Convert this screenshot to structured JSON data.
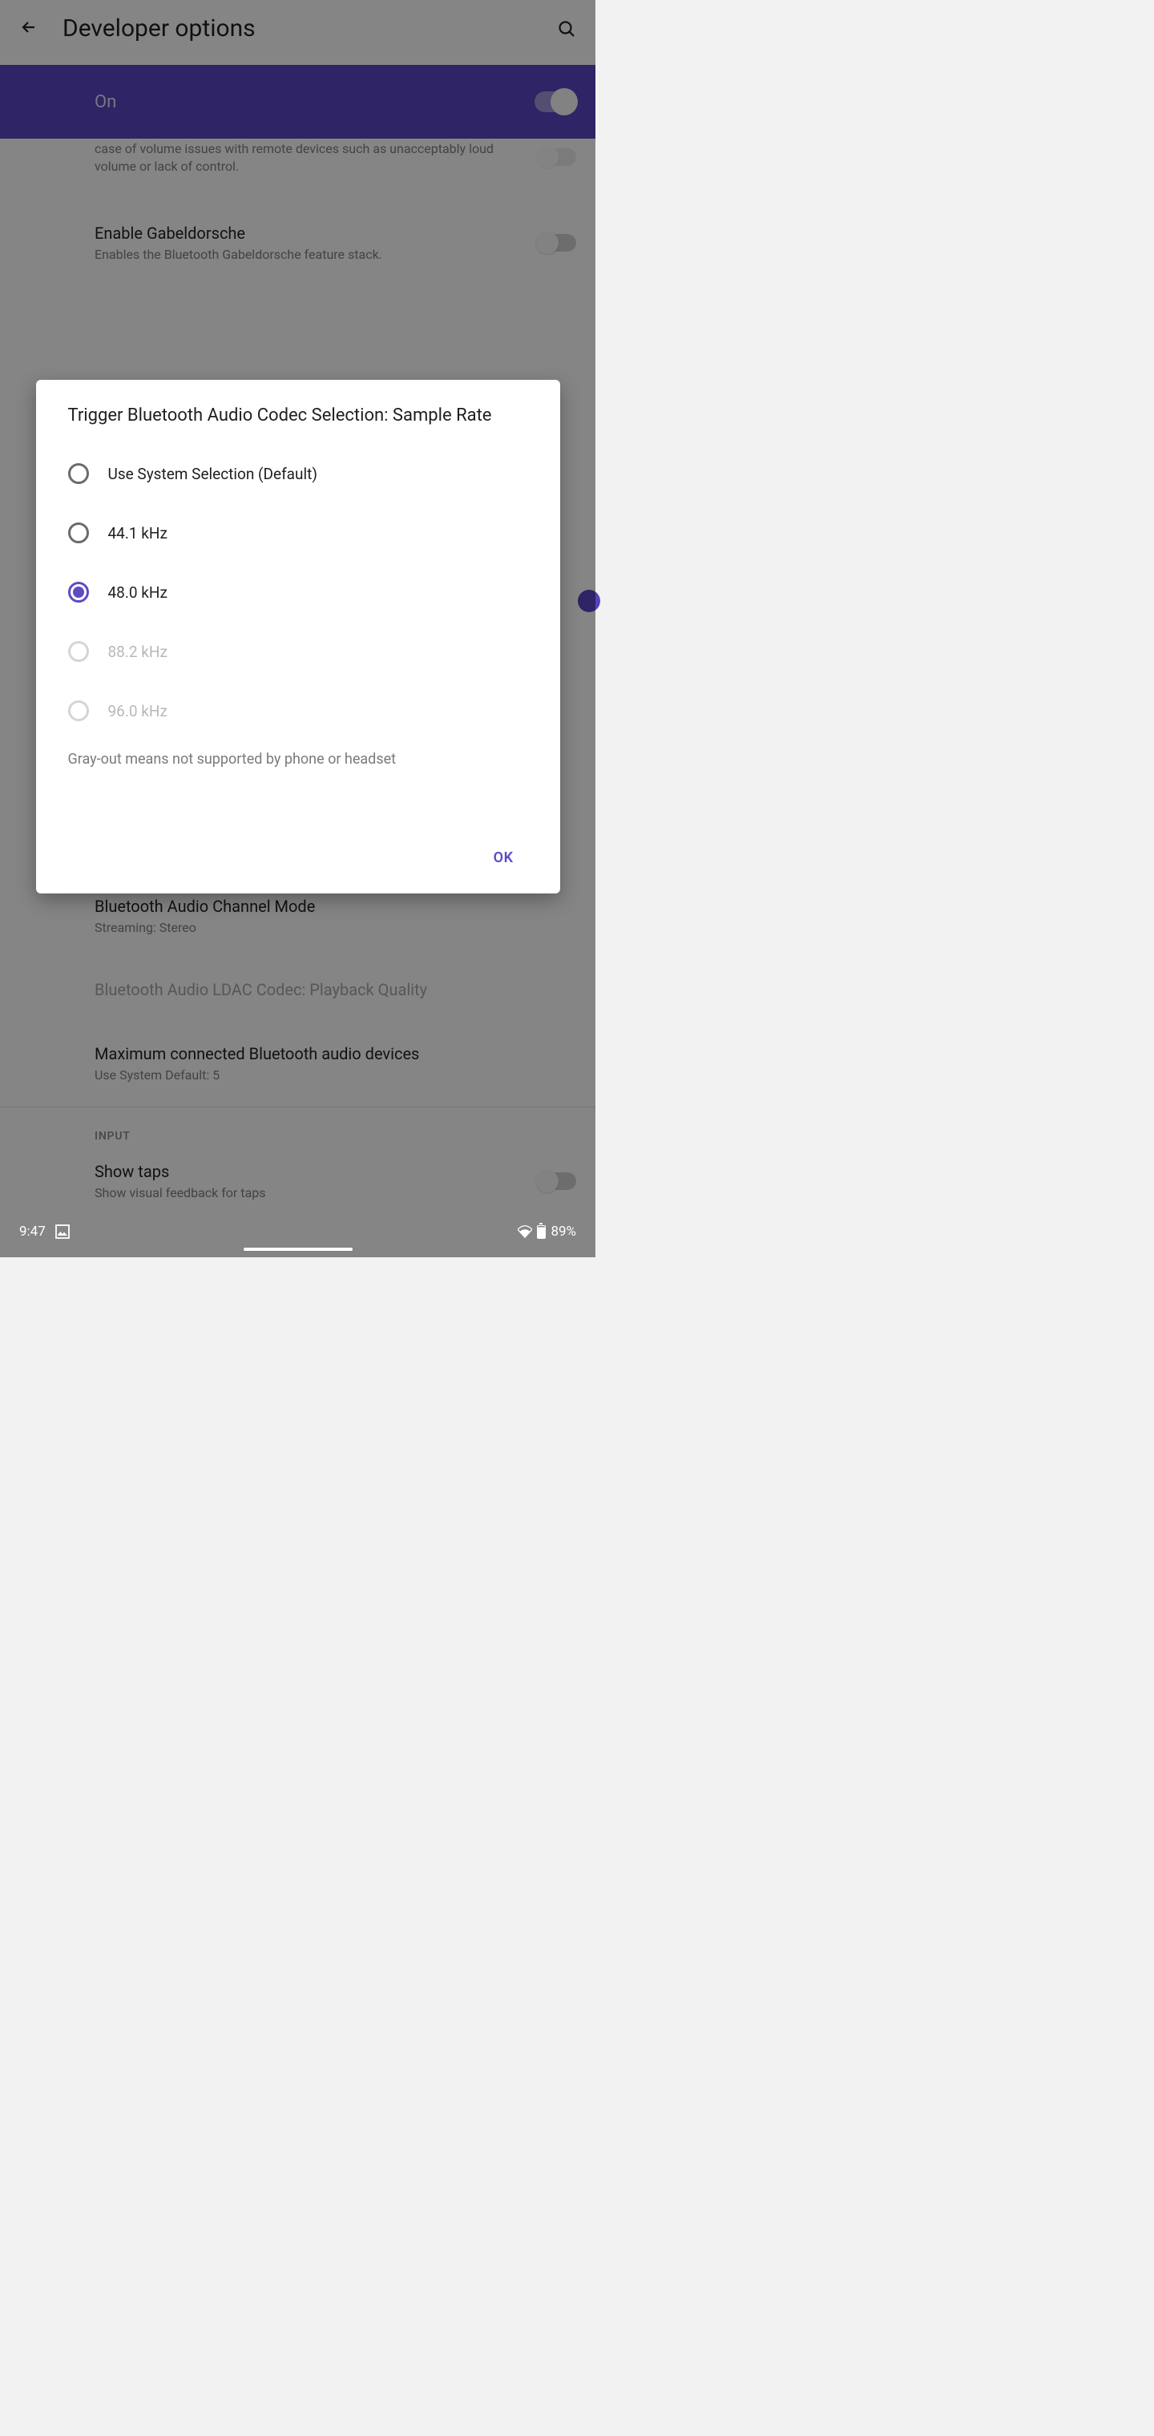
{
  "status": {
    "time": "9:47",
    "battery": "89%"
  },
  "header": {
    "title": "Developer options"
  },
  "banner": {
    "state": "On"
  },
  "items_before": [
    {
      "title": "",
      "sub": "case of volume issues with remote devices such as unacceptably loud volume or lack of control.",
      "partial": true
    },
    {
      "title": "Enable Gabeldorsche",
      "sub": "Enables the Bluetooth Gabeldorsche feature stack.",
      "toggle_off": true
    }
  ],
  "items_after": [
    {
      "title": "Bluetooth Audio Channel Mode",
      "sub": "Streaming: Stereo"
    },
    {
      "title": "Bluetooth Audio LDAC Codec: Playback Quality",
      "sub": "",
      "disabled": true
    },
    {
      "title": "Maximum connected Bluetooth audio devices",
      "sub": "Use System Default: 5"
    }
  ],
  "section": {
    "label": "INPUT"
  },
  "input_items": [
    {
      "title": "Show taps",
      "sub": "Show visual feedback for taps"
    }
  ],
  "dialog": {
    "title": "Trigger Bluetooth Audio Codec Selection: Sample Rate",
    "options": [
      {
        "label": "Use System Selection (Default)",
        "state": "off"
      },
      {
        "label": "44.1 kHz",
        "state": "off"
      },
      {
        "label": "48.0 kHz",
        "state": "selected"
      },
      {
        "label": "88.2 kHz",
        "state": "disabled"
      },
      {
        "label": "96.0 kHz",
        "state": "disabled"
      }
    ],
    "note": "Gray-out means not supported by phone or headset",
    "ok": "OK"
  }
}
